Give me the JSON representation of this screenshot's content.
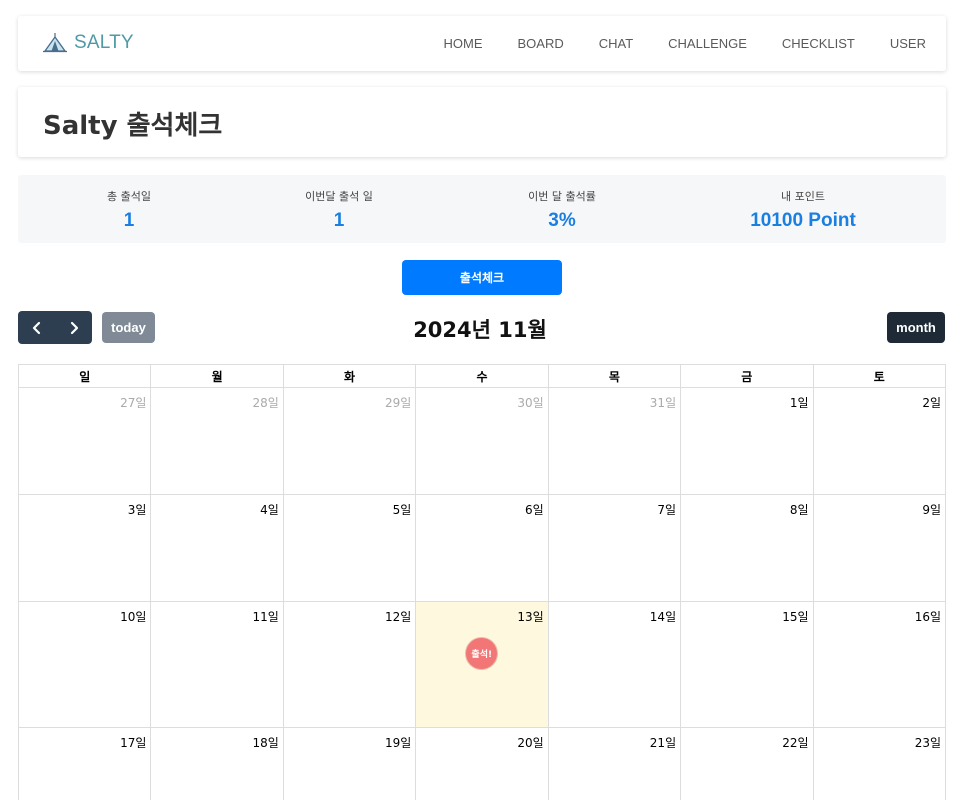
{
  "brand": {
    "name": "SALTY",
    "logo_icon": "tent-icon"
  },
  "nav": [
    "HOME",
    "BOARD",
    "CHAT",
    "CHALLENGE",
    "CHECKLIST",
    "USER"
  ],
  "page": {
    "title": "Salty 출석체크"
  },
  "stats": [
    {
      "label": "총 출석일",
      "value": "1"
    },
    {
      "label": "이번달 출석 일",
      "value": "1"
    },
    {
      "label": "이번 달 출석률",
      "value": "3%"
    },
    {
      "label": "내 포인트",
      "value": "10100 Point"
    }
  ],
  "checkin_button": "출석체크",
  "calendar": {
    "title": "2024년 11월",
    "today_label": "today",
    "month_label": "month",
    "weekdays": [
      "일",
      "월",
      "화",
      "수",
      "목",
      "금",
      "토"
    ],
    "weeks": [
      [
        {
          "label": "27일",
          "other": true
        },
        {
          "label": "28일",
          "other": true
        },
        {
          "label": "29일",
          "other": true
        },
        {
          "label": "30일",
          "other": true
        },
        {
          "label": "31일",
          "other": true
        },
        {
          "label": "1일"
        },
        {
          "label": "2일"
        }
      ],
      [
        {
          "label": "3일"
        },
        {
          "label": "4일"
        },
        {
          "label": "5일"
        },
        {
          "label": "6일"
        },
        {
          "label": "7일"
        },
        {
          "label": "8일"
        },
        {
          "label": "9일"
        }
      ],
      [
        {
          "label": "10일"
        },
        {
          "label": "11일"
        },
        {
          "label": "12일"
        },
        {
          "label": "13일",
          "today": true,
          "stamp": "출석!"
        },
        {
          "label": "14일"
        },
        {
          "label": "15일"
        },
        {
          "label": "16일"
        }
      ],
      [
        {
          "label": "17일"
        },
        {
          "label": "18일"
        },
        {
          "label": "19일"
        },
        {
          "label": "20일"
        },
        {
          "label": "21일"
        },
        {
          "label": "22일"
        },
        {
          "label": "23일"
        }
      ]
    ]
  },
  "colors": {
    "brand": "#4f9aa6",
    "accent": "#007bff",
    "stat_value": "#1a7fe0",
    "today_bg": "#fdf8de",
    "stamp": "#f27676",
    "nav_button": "#2c3e50"
  }
}
